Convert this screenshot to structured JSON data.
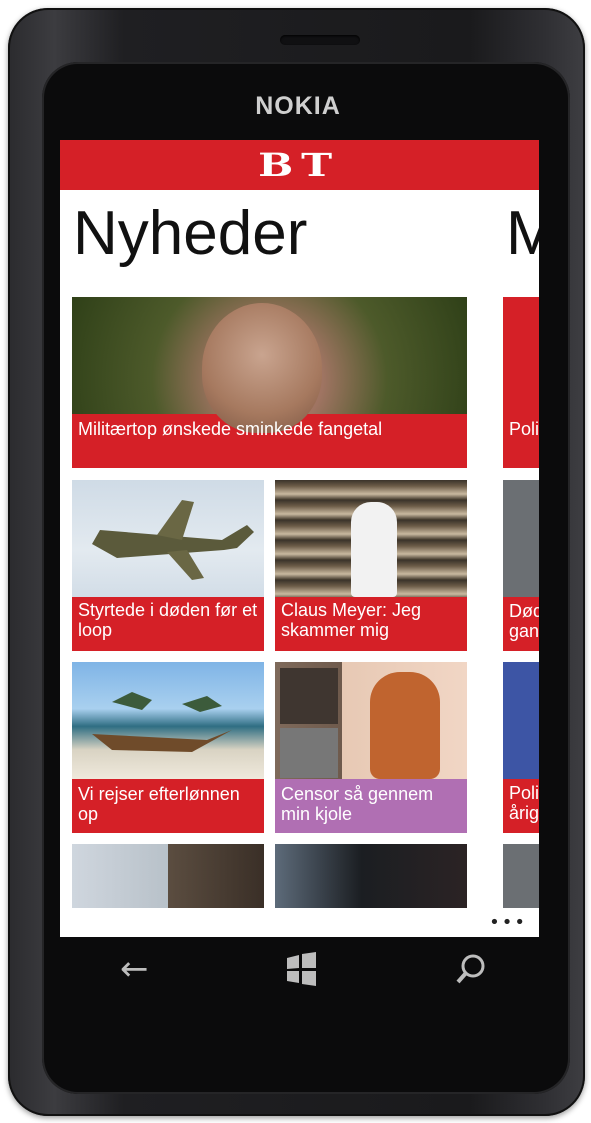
{
  "device": {
    "brand": "NOKIA"
  },
  "app": {
    "logo": "BT",
    "pivot": {
      "current_title": "Nyheder",
      "next_title_peek": "M"
    }
  },
  "tiles": [
    {
      "caption": "Militærtop ønskede sminkede fangetal"
    },
    {
      "caption": "Styrtede i døden før et loop"
    },
    {
      "caption": "Claus Meyer: Jeg skammer mig"
    },
    {
      "caption": "Vi rejser efterlønnen op"
    },
    {
      "caption": "Censor så gennem min kjole"
    }
  ],
  "peek_tiles": [
    {
      "caption": "Poli"
    },
    {
      "caption": "Død gan"
    },
    {
      "caption": "Poli årig"
    }
  ],
  "appbar": {
    "more": "•••"
  },
  "nav": {
    "back": "←",
    "windows": "⊞",
    "search": "⚲"
  },
  "colors": {
    "accent": "#d52027",
    "tile_purple": "#b06fb3"
  }
}
